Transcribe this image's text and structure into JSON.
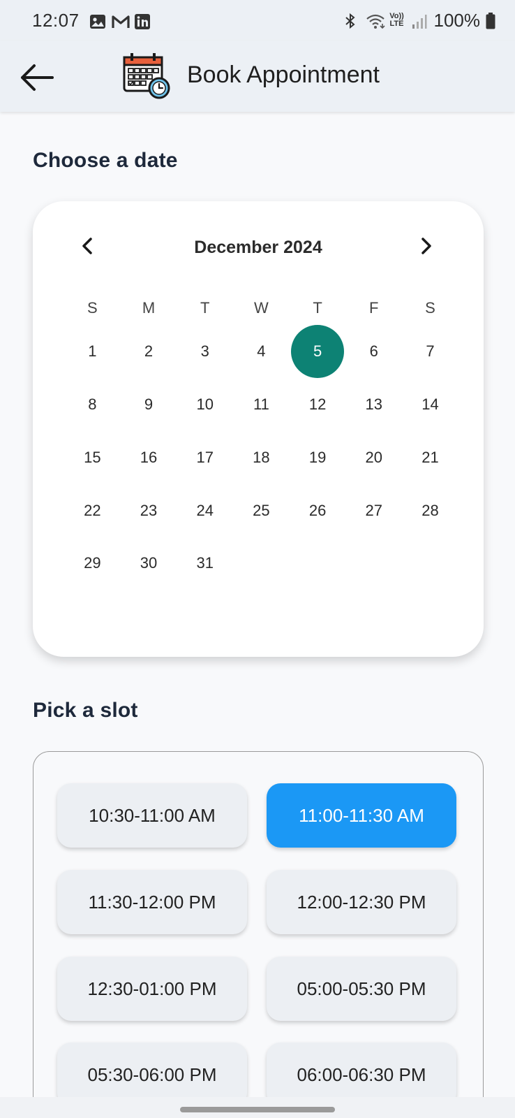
{
  "status_bar": {
    "time": "12:07",
    "battery": "100%",
    "icons_left": [
      "gallery-icon",
      "gmail-icon",
      "linkedin-icon"
    ],
    "icons_right": [
      "bluetooth-icon",
      "wifi-icon",
      "volte-icon",
      "signal-icon",
      "battery-icon"
    ],
    "volte_text": "Vo)) LTE"
  },
  "app_bar": {
    "title": "Book Appointment"
  },
  "date_section": {
    "heading": "Choose a date"
  },
  "calendar": {
    "month_label": "December 2024",
    "weekdays": [
      "S",
      "M",
      "T",
      "W",
      "T",
      "F",
      "S"
    ],
    "weeks": [
      [
        "1",
        "2",
        "3",
        "4",
        "5",
        "6",
        "7"
      ],
      [
        "8",
        "9",
        "10",
        "11",
        "12",
        "13",
        "14"
      ],
      [
        "15",
        "16",
        "17",
        "18",
        "19",
        "20",
        "21"
      ],
      [
        "22",
        "23",
        "24",
        "25",
        "26",
        "27",
        "28"
      ],
      [
        "29",
        "30",
        "31"
      ]
    ],
    "selected_day": "5",
    "selected_color": "#0d8274"
  },
  "slot_section": {
    "heading": "Pick a slot"
  },
  "slots": [
    {
      "label": "10:30-11:00 AM",
      "selected": false
    },
    {
      "label": "11:00-11:30 AM",
      "selected": true
    },
    {
      "label": "11:30-12:00 PM",
      "selected": false
    },
    {
      "label": "12:00-12:30 PM",
      "selected": false
    },
    {
      "label": "12:30-01:00 PM",
      "selected": false
    },
    {
      "label": "05:00-05:30 PM",
      "selected": false
    },
    {
      "label": "05:30-06:00 PM",
      "selected": false
    },
    {
      "label": "06:00-06:30 PM",
      "selected": false
    }
  ],
  "colors": {
    "accent": "#1b98f5",
    "header_bg": "#ecf0f5",
    "selected_date": "#0d8274"
  }
}
